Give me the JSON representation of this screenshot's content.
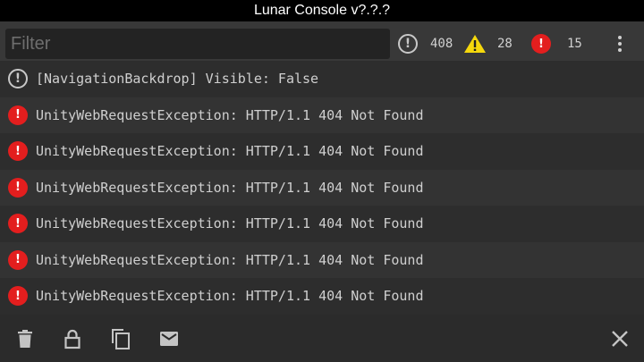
{
  "window": {
    "title": "Lunar Console v?.?.?"
  },
  "filter": {
    "placeholder": "Filter",
    "value": ""
  },
  "counters": {
    "info": "408",
    "warning": "28",
    "error": "15"
  },
  "colors": {
    "error": "#e31e1e",
    "warning": "#f5d80c",
    "info": "#c8c8c8"
  },
  "log": [
    {
      "level": "info",
      "text": "[NavigationBackdrop] Visible: False"
    },
    {
      "level": "error",
      "text": "UnityWebRequestException: HTTP/1.1 404 Not Found"
    },
    {
      "level": "error",
      "text": "UnityWebRequestException: HTTP/1.1 404 Not Found"
    },
    {
      "level": "error",
      "text": "UnityWebRequestException: HTTP/1.1 404 Not Found"
    },
    {
      "level": "error",
      "text": "UnityWebRequestException: HTTP/1.1 404 Not Found"
    },
    {
      "level": "error",
      "text": "UnityWebRequestException: HTTP/1.1 404 Not Found"
    },
    {
      "level": "error",
      "text": "UnityWebRequestException: HTTP/1.1 404 Not Found"
    }
  ],
  "icons": {
    "info_glyph": "!",
    "error_glyph": "!",
    "bottom": [
      "trash-icon",
      "lock-icon",
      "copy-icon",
      "mail-icon",
      "close-icon"
    ]
  }
}
